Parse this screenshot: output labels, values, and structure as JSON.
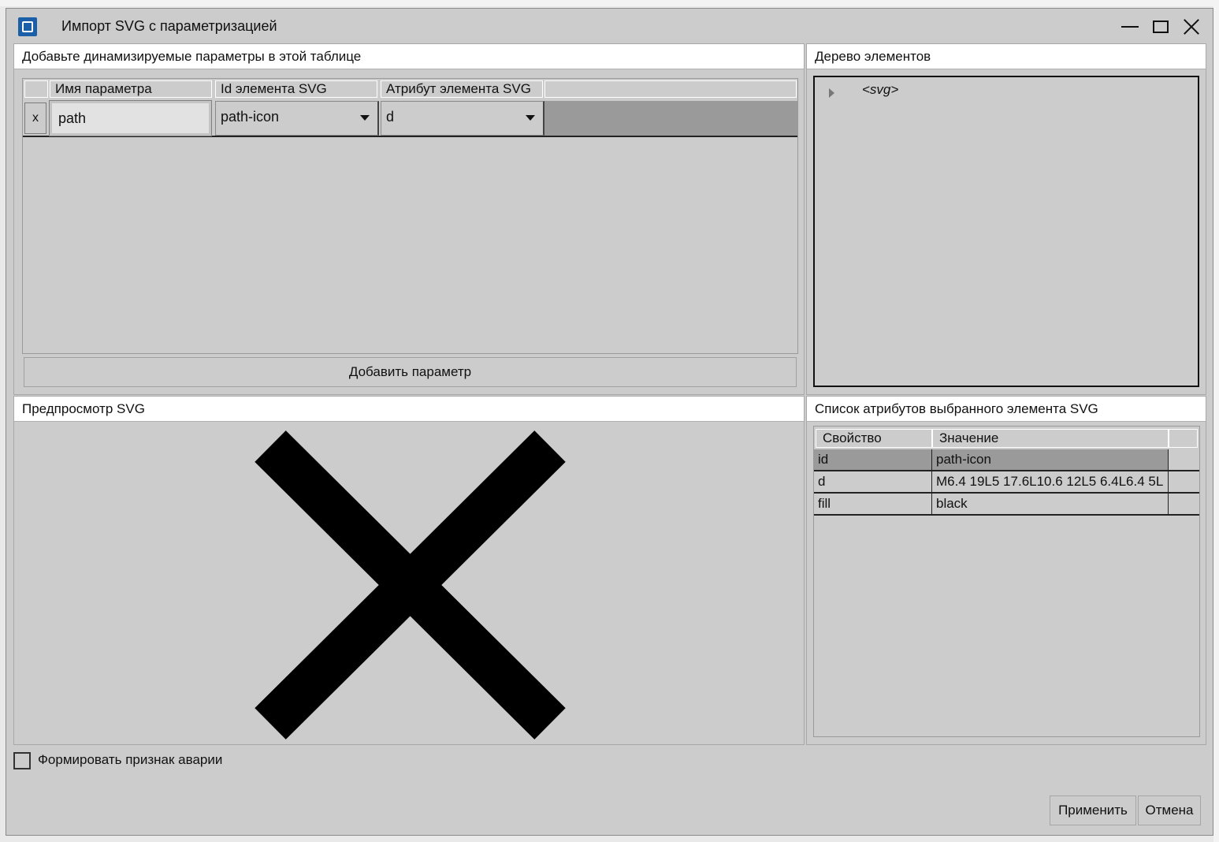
{
  "window": {
    "title": "Импорт SVG с параметризацией"
  },
  "params_panel": {
    "header": "Добавьте динамизируемые параметры в этой таблице",
    "columns": [
      "Имя параметра",
      "Id элемента SVG",
      "Атрибут элемента SVG"
    ],
    "rows": [
      {
        "delete_label": "x",
        "name": "path",
        "element_id": "path-icon",
        "attribute": "d"
      }
    ],
    "add_button": "Добавить параметр"
  },
  "tree_panel": {
    "header": "Дерево элементов",
    "items": [
      {
        "label": "<svg>",
        "icon": "expand-arrow-icon"
      }
    ]
  },
  "preview_panel": {
    "header": "Предпросмотр SVG",
    "icon": "close-icon",
    "fill": "#000000"
  },
  "attrs_panel": {
    "header": "Список атрибутов выбранного элемента SVG",
    "columns": [
      "Свойство",
      "Значение"
    ],
    "rows": [
      {
        "property": "id",
        "value": "path-icon"
      },
      {
        "property": "d",
        "value": "M6.4 19L5 17.6L10.6 12L5 6.4L6.4 5L"
      },
      {
        "property": "fill",
        "value": "black"
      }
    ]
  },
  "alarm_checkbox": {
    "label": "Формировать признак аварии",
    "checked": false
  },
  "buttons": {
    "apply": "Применить",
    "cancel": "Отмена"
  },
  "colors": {
    "accent": "#1b5fa8",
    "background": "#cccccc",
    "selection": "#9a9a9a"
  }
}
